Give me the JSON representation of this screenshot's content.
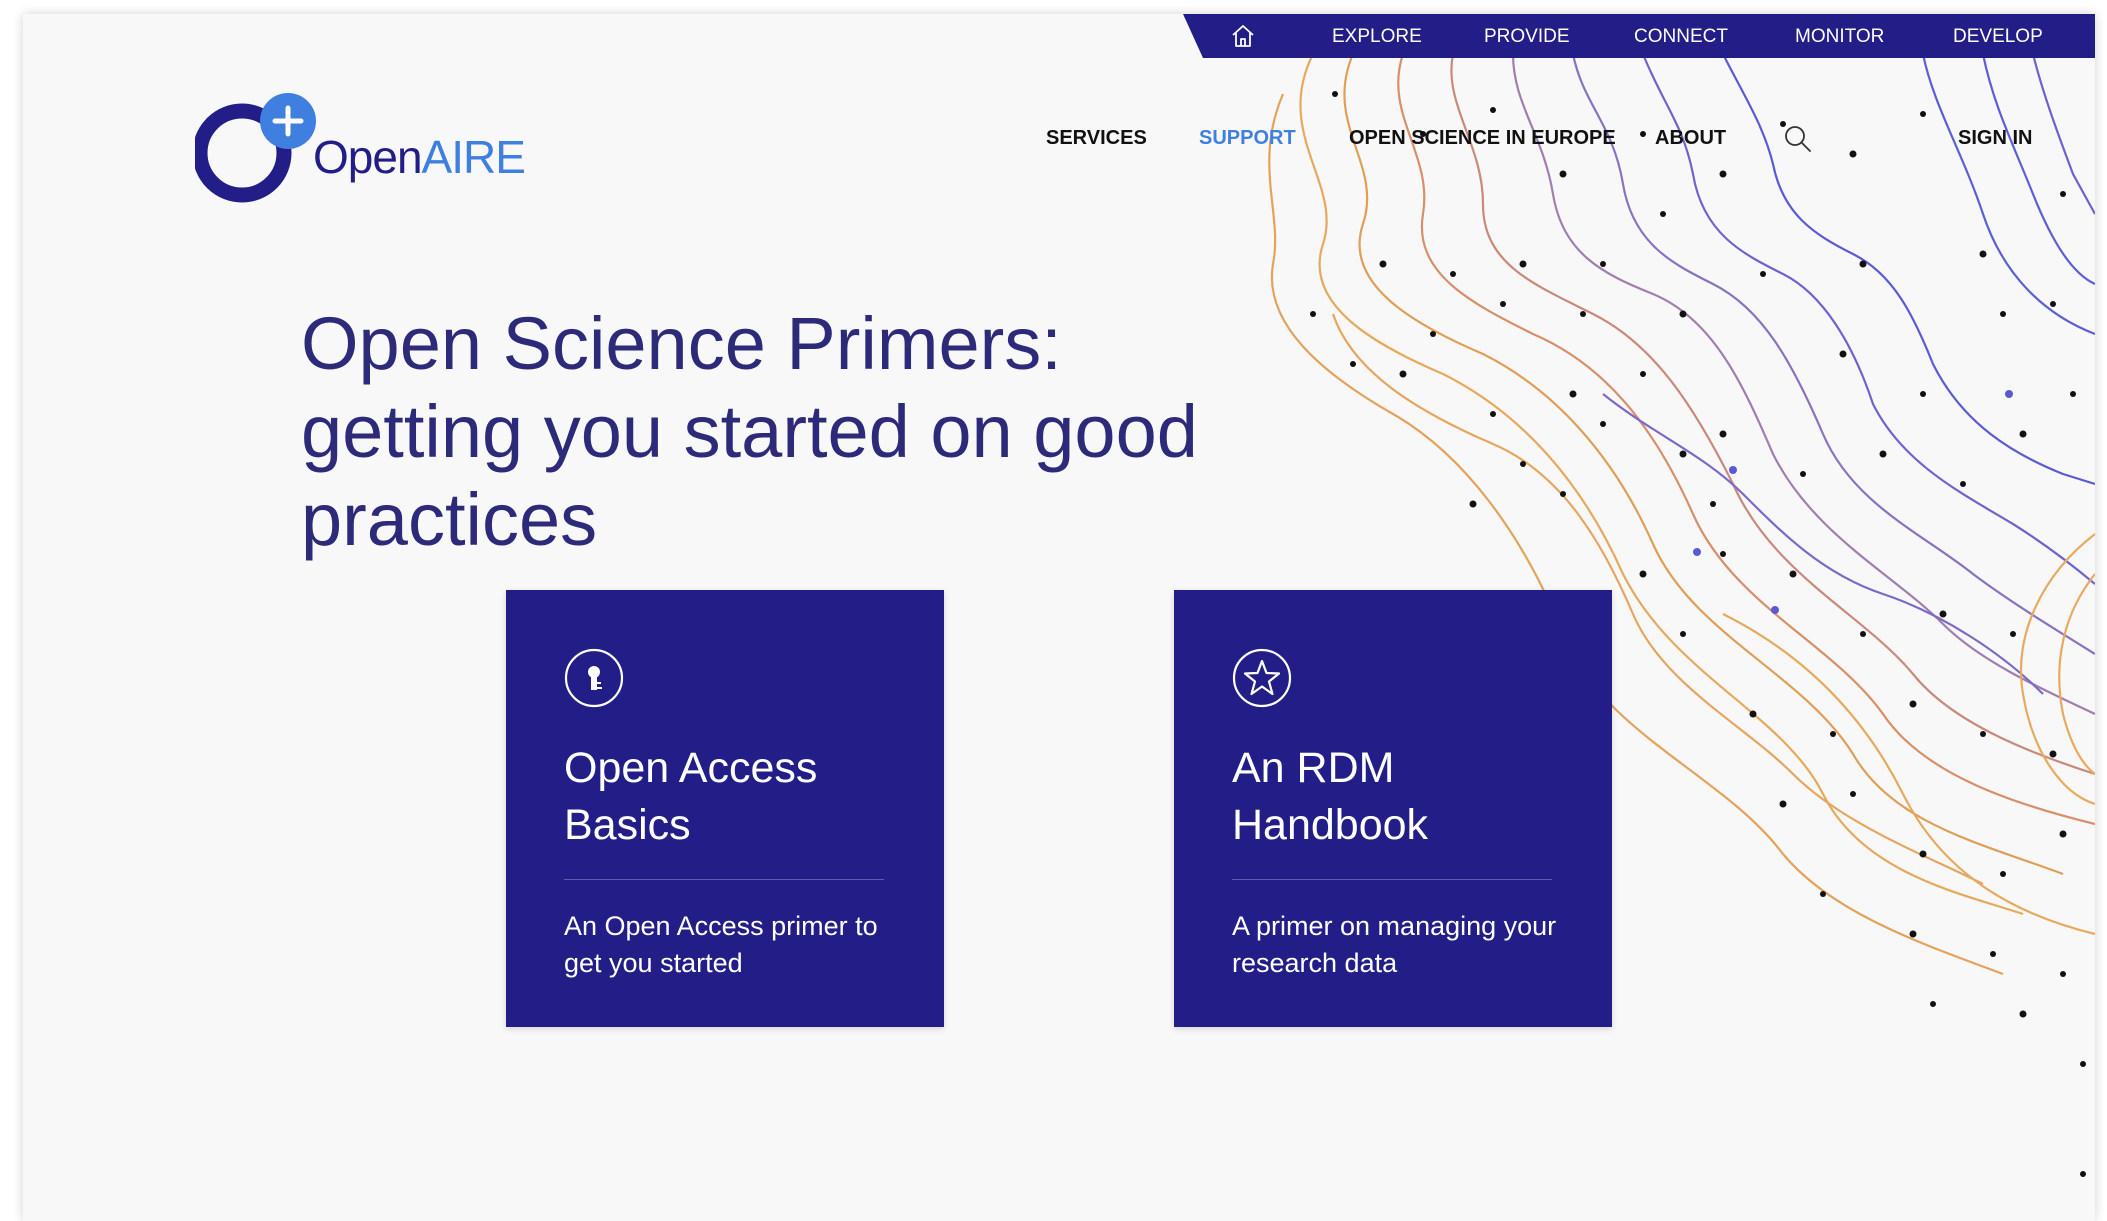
{
  "top_nav": {
    "home_icon": "home-icon",
    "items": [
      "EXPLORE",
      "PROVIDE",
      "CONNECT",
      "MONITOR",
      "DEVELOP"
    ]
  },
  "logo": {
    "part1": "Open",
    "part2": "AIRE"
  },
  "main_nav": {
    "items": [
      "SERVICES",
      "SUPPORT",
      "OPEN SCIENCE IN EUROPE",
      "ABOUT"
    ],
    "active": "SUPPORT",
    "search_icon": "search-icon",
    "sign_in": "SIGN IN"
  },
  "hero": {
    "title": "Open Science Primers: getting you started on good practices"
  },
  "cards": [
    {
      "icon": "keyhole-icon",
      "title": "Open Access Basics",
      "description": "An Open Access primer to get you started"
    },
    {
      "icon": "star-icon",
      "title": "An RDM Handbook",
      "description": "A primer on managing your research data"
    }
  ],
  "colors": {
    "brand_navy": "#231e87",
    "brand_blue": "#3f7fe0",
    "hero_text": "#2d2a7a",
    "background": "#f8f8f9",
    "contour_orange": "#e0a458",
    "contour_purple": "#6b5cc8"
  }
}
